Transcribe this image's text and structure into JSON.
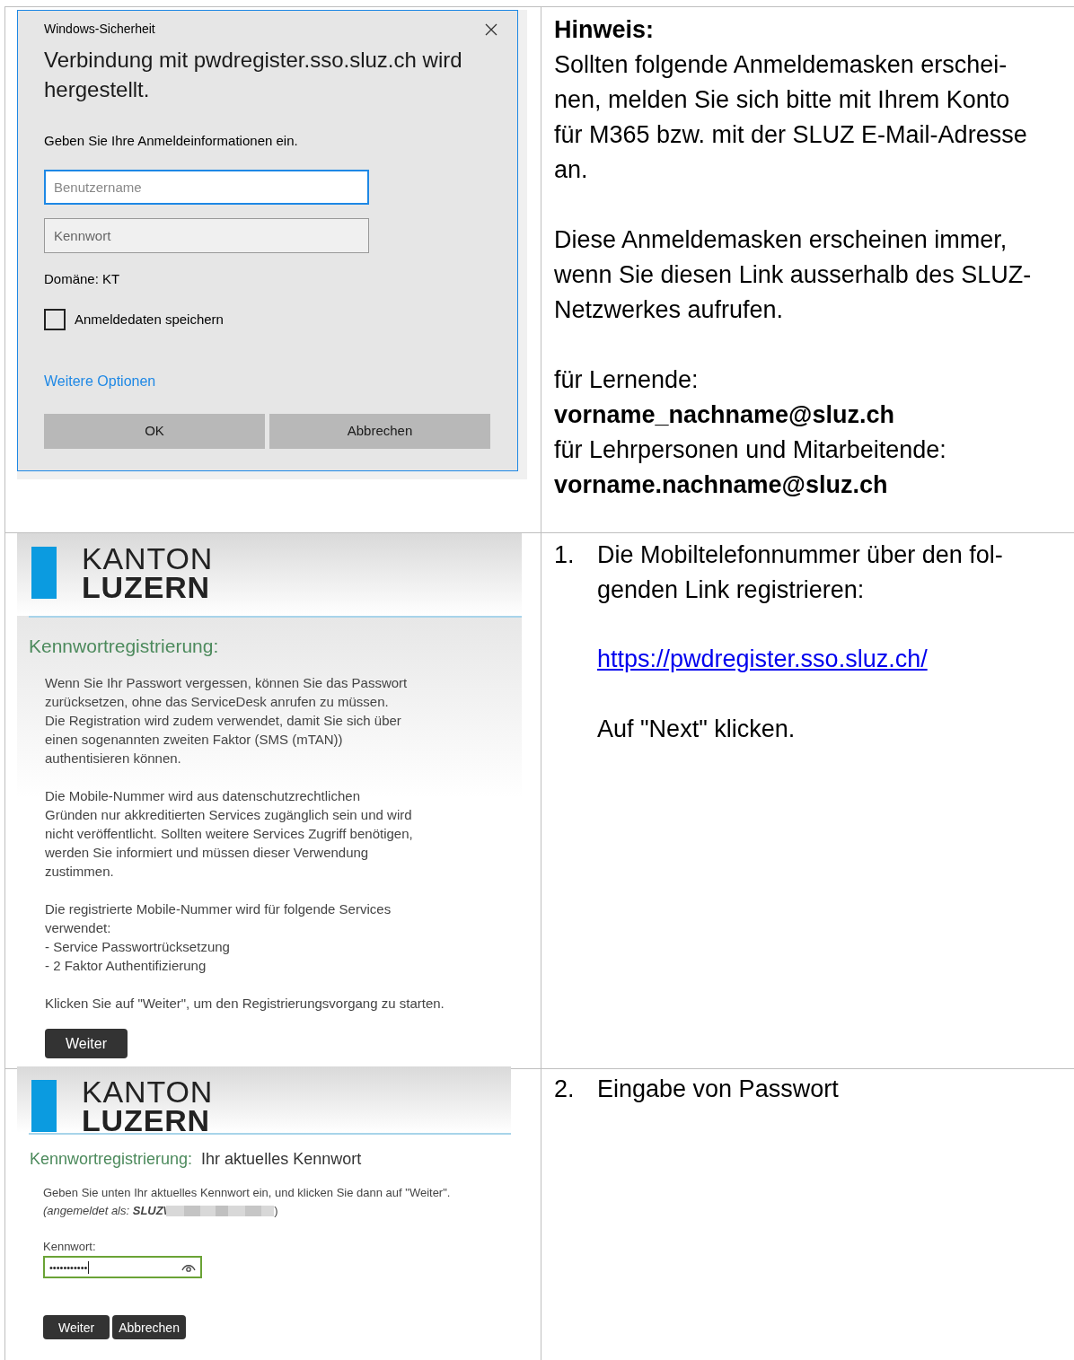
{
  "dialog": {
    "title": "Windows-Sicherheit",
    "heading": "Verbindung mit pwdregister.sso.sluz.ch wird hergestellt.",
    "instruction": "Geben Sie Ihre Anmeldeinformationen ein.",
    "username_placeholder": "Benutzername",
    "password_placeholder": "Kennwort",
    "domain": "Domäne: KT",
    "remember": {
      "label": "Anmeldedaten speichern",
      "checked": false
    },
    "more_options": "Weitere Optionen",
    "buttons": [
      "OK",
      "Abbrechen"
    ]
  },
  "hint": {
    "title": "Hinweis:",
    "paragraphs": [
      {
        "lines": [
          "Sollten folgende Anmeldemasken erschei-",
          "nen, melden Sie sich bitte mit Ihrem Konto",
          "für M365 bzw. mit der SLUZ E-Mail-Adresse",
          "an."
        ]
      },
      {
        "lines": [
          "Diese Anmeldemasken erscheinen immer,",
          "wenn Sie diesen Link ausserhalb des SLUZ-",
          "Netzwerkes aufrufen."
        ]
      },
      {
        "lines": [
          "für Lernende:",
          "**vorname_nachname@sluz.ch**",
          "für Lehrpersonen und Mitarbeitende:",
          "**vorname.nachname@sluz.ch**"
        ]
      }
    ]
  },
  "registration": {
    "logo": [
      "KANTON",
      "LUZERN"
    ],
    "heading": "Kennwortregistrierung:",
    "paragraphs": [
      {
        "lines": [
          "Wenn Sie Ihr Passwort vergessen, können Sie das Passwort",
          "zurücksetzen, ohne das ServiceDesk anrufen zu müssen.",
          "Die Registration wird zudem verwendet, damit Sie sich über",
          "einen sogenannten zweiten Faktor (SMS (mTAN))",
          "authentisieren können."
        ]
      },
      {
        "lines": [
          "Die Mobile-Nummer wird aus datenschutzrechtlichen",
          "Gründen nur akkreditierten Services zugänglich sein und wird",
          "nicht veröffentlicht. Sollten weitere Services Zugriff benötigen,",
          "werden Sie informiert und müssen dieser Verwendung",
          "zustimmen."
        ]
      },
      {
        "lines": [
          "Die registrierte Mobile-Nummer wird für folgende Services",
          "verwendet:",
          "- Service Passwortrücksetzung",
          "- 2 Faktor Authentifizierung"
        ]
      },
      {
        "lines": [
          "Klicken Sie auf \"Weiter\", um den Registrierungsvorgang zu starten."
        ]
      }
    ],
    "button": "Weiter"
  },
  "step1": {
    "number": "1.",
    "lines": [
      "Die Mobiltelefonnummer über den fol-",
      "genden Link registrieren:"
    ],
    "link": "https://pwdregister.sso.sluz.ch/",
    "note": "Auf \"Next\" klicken."
  },
  "password_page": {
    "logo": [
      "KANTON",
      "LUZERN"
    ],
    "heading": "Kennwortregistrierung:",
    "subheading": "Ihr aktuelles Kennwort",
    "instruction": "Geben Sie unten Ihr aktuelles Kennwort ein, und klicken Sie dann auf \"Weiter\".",
    "signed_in": "(angemeldet als: **SLUZ\\**",
    "signed_in_end": ")",
    "field_label": "Kennwort:",
    "value": "•••••••••••",
    "buttons": [
      "Weiter",
      "Abbrechen"
    ]
  },
  "step2": {
    "number": "2.",
    "text": "Eingabe von Passwort"
  }
}
